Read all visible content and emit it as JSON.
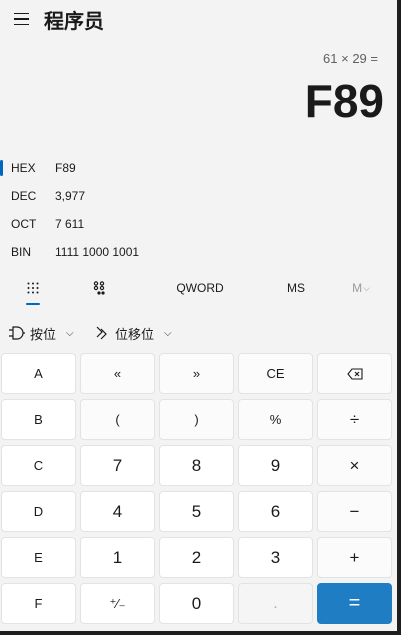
{
  "header": {
    "title": "程序员"
  },
  "display": {
    "expression": "61 × 29 =",
    "result": "F89"
  },
  "radix": [
    {
      "label": "HEX",
      "value": "F89",
      "selected": true
    },
    {
      "label": "DEC",
      "value": "3,977",
      "selected": false
    },
    {
      "label": "OCT",
      "value": "7 611",
      "selected": false
    },
    {
      "label": "BIN",
      "value": "1111 1000 1001",
      "selected": false
    }
  ],
  "mode_bar": {
    "word_size": "QWORD",
    "ms": "MS",
    "mplus": "M"
  },
  "bitwise": {
    "bitwise_label": "按位",
    "shift_label": "位移位"
  },
  "keys": [
    [
      "A",
      "«",
      "»",
      "CE",
      "⌫"
    ],
    [
      "B",
      "(",
      ")",
      "%",
      "÷"
    ],
    [
      "C",
      "7",
      "8",
      "9",
      "×"
    ],
    [
      "D",
      "4",
      "5",
      "6",
      "−"
    ],
    [
      "E",
      "1",
      "2",
      "3",
      "+"
    ],
    [
      "F",
      "⁺∕₋",
      "0",
      ".",
      "="
    ]
  ],
  "colors": {
    "accent": "#0067c0",
    "equals_bg": "#1f7dc4",
    "background": "#f3f3f3"
  }
}
